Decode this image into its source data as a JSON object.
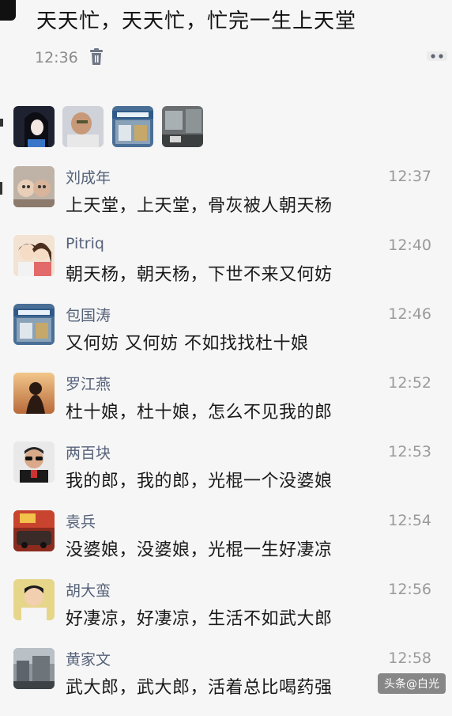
{
  "post": {
    "title": "天天忙，天天忙，忙完一生上天堂",
    "time": "12:36"
  },
  "icons": {
    "delete": "trash-icon",
    "more": "more-dots-icon"
  },
  "likes": [
    {
      "avatar_icon": "avatar-girl-icon"
    },
    {
      "avatar_icon": "avatar-man-icon"
    },
    {
      "avatar_icon": "avatar-building-icon"
    },
    {
      "avatar_icon": "avatar-room-icon"
    }
  ],
  "comments": [
    {
      "name": "刘成年",
      "time": "12:37",
      "text": "上天堂，上天堂，骨灰被人朝天杨",
      "avatar_icon": "avatar-cartoon-icon"
    },
    {
      "name": "Pitriq",
      "time": "12:40",
      "text": "朝天杨，朝天杨，下世不来又何妨",
      "avatar_icon": "avatar-couple-icon"
    },
    {
      "name": "包国涛",
      "time": "12:46",
      "text": "又何妨 又何妨 不如找找杜十娘",
      "avatar_icon": "avatar-building-icon"
    },
    {
      "name": "罗江燕",
      "time": "12:52",
      "text": "杜十娘，杜十娘，怎么不见我的郎",
      "avatar_icon": "avatar-sunset-icon"
    },
    {
      "name": "两百块",
      "time": "12:53",
      "text": "我的郎，我的郎，光棍一个没婆娘",
      "avatar_icon": "avatar-sunglasses-icon"
    },
    {
      "name": "袁兵",
      "time": "12:54",
      "text": "没婆娘，没婆娘，光棍一生好凄凉",
      "avatar_icon": "avatar-car-icon"
    },
    {
      "name": "胡大蛮",
      "time": "12:56",
      "text": "好凄凉，好凄凉，生活不如武大郎",
      "avatar_icon": "avatar-boy-icon"
    },
    {
      "name": "黄家文",
      "time": "12:58",
      "text": "武大郎，武大郎，活着总比喝药强",
      "avatar_icon": "avatar-street-icon"
    }
  ],
  "watermark": {
    "bottom": "头条@白光"
  },
  "colors": {
    "background": "#f6f6f6",
    "name": "#56627a",
    "time": "#9a9a9a",
    "text": "#1a1a1a"
  }
}
